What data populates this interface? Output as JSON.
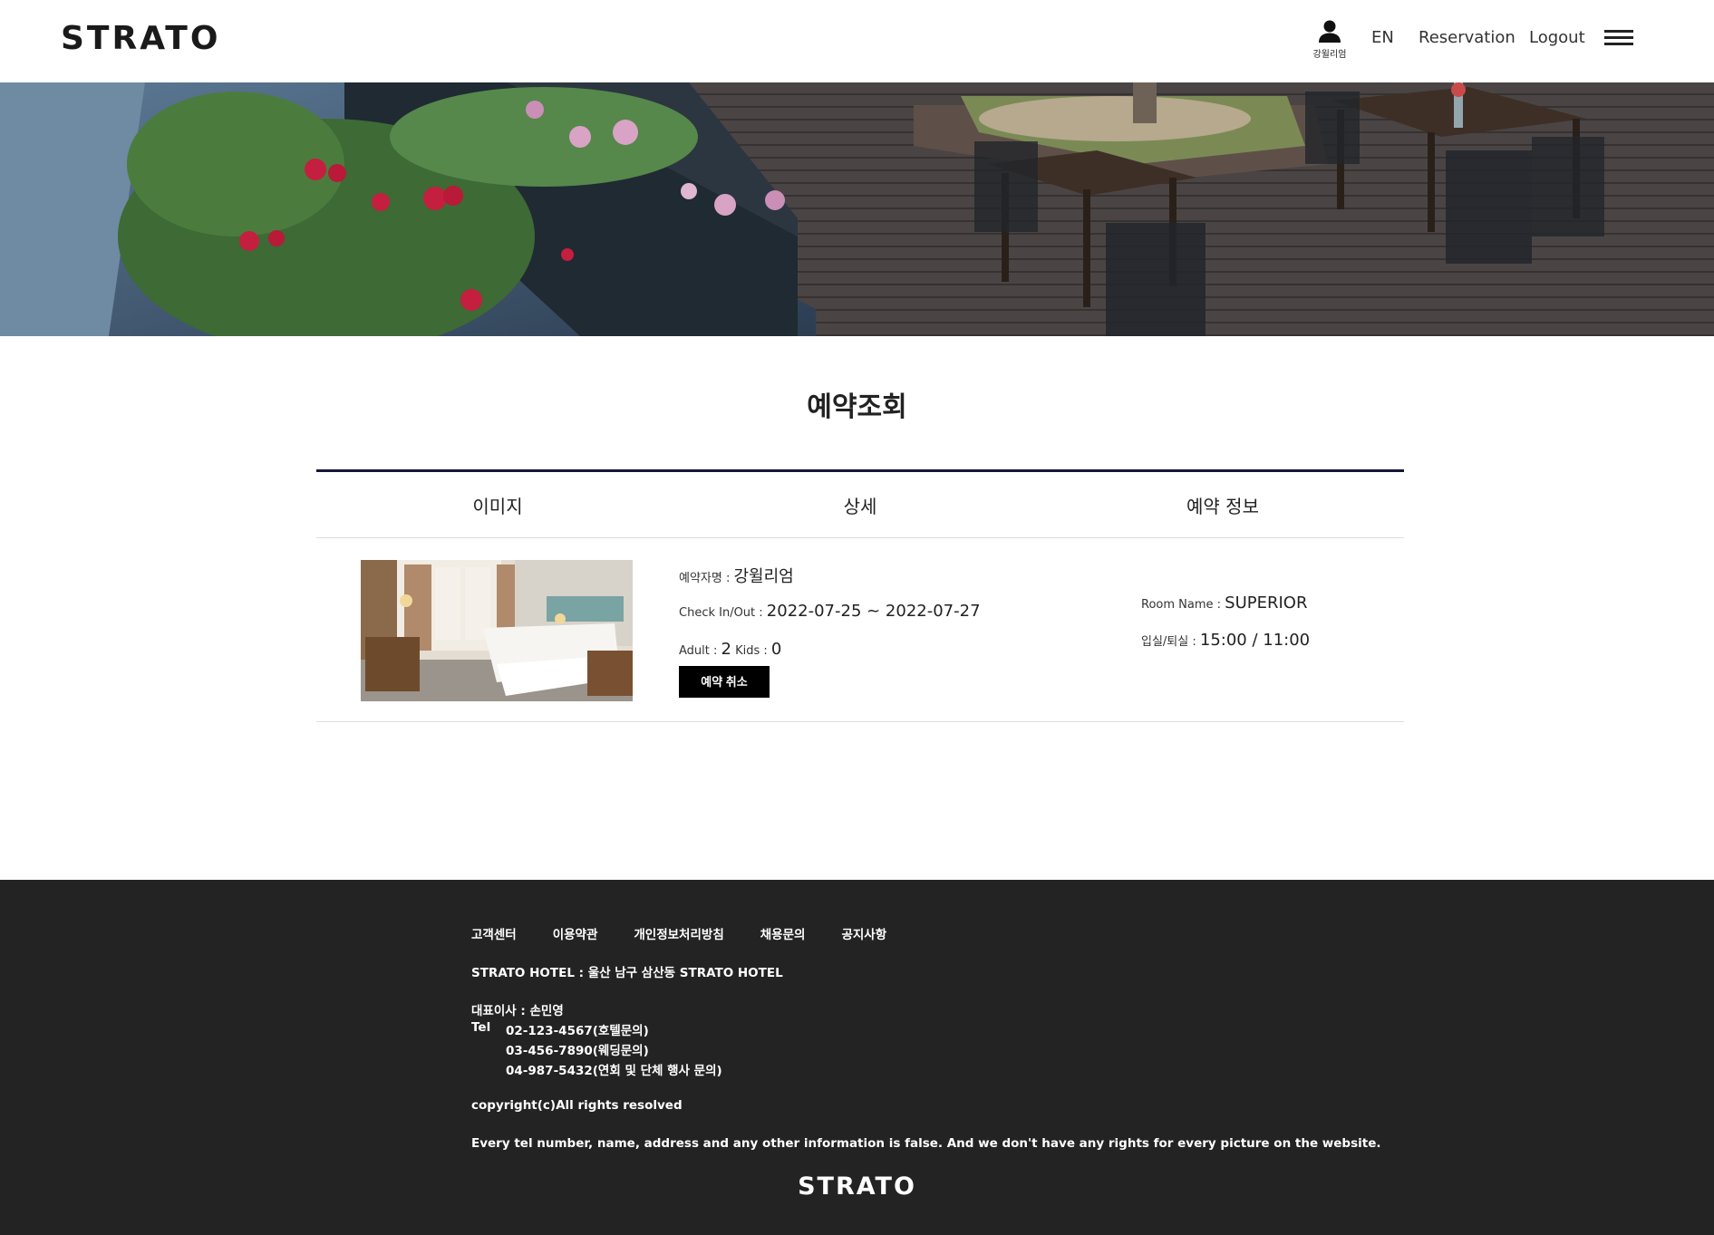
{
  "header": {
    "logo": "STRATO",
    "user_name": "강윌리엄",
    "lang": "EN",
    "reservation": "Reservation",
    "logout": "Logout"
  },
  "page": {
    "title": "예약조회"
  },
  "table": {
    "headers": [
      "이미지",
      "상세",
      "예약 정보"
    ],
    "row": {
      "guest_label": "예약자명 : ",
      "guest_value": "강윌리엄",
      "checkinout_label": "Check In/Out : ",
      "checkinout_value": "2022-07-25 ~ 2022-07-27",
      "adult_label": "Adult : ",
      "adult_value": "2",
      "kids_label": " Kids : ",
      "kids_value": "0",
      "cancel_button": "예약 취소",
      "room_name_label": "Room Name : ",
      "room_name_value": "SUPERIOR",
      "time_label": "입실/퇴실 : ",
      "time_value": "15:00 / 11:00"
    }
  },
  "footer": {
    "links": [
      "고객센터",
      "이용약관",
      "개인정보처리방침",
      "채용문의",
      "공지사항"
    ],
    "hotel": "STRATO HOTEL : 울산 남구 삼산동 STRATO HOTEL",
    "ceo": "대표이사 : 손민영",
    "tel_label": "Tel",
    "tel1": "02-123-4567(호텔문의)",
    "tel2": "03-456-7890(웨딩문의)",
    "tel3": "04-987-5432(연회 및 단체 행사 문의)",
    "copyright": "copyright(c)All rights resolved",
    "disclaimer": "Every tel number, name, address and any other information is false. And we don't have any rights for every picture on the website.",
    "logo": "STRATO"
  }
}
